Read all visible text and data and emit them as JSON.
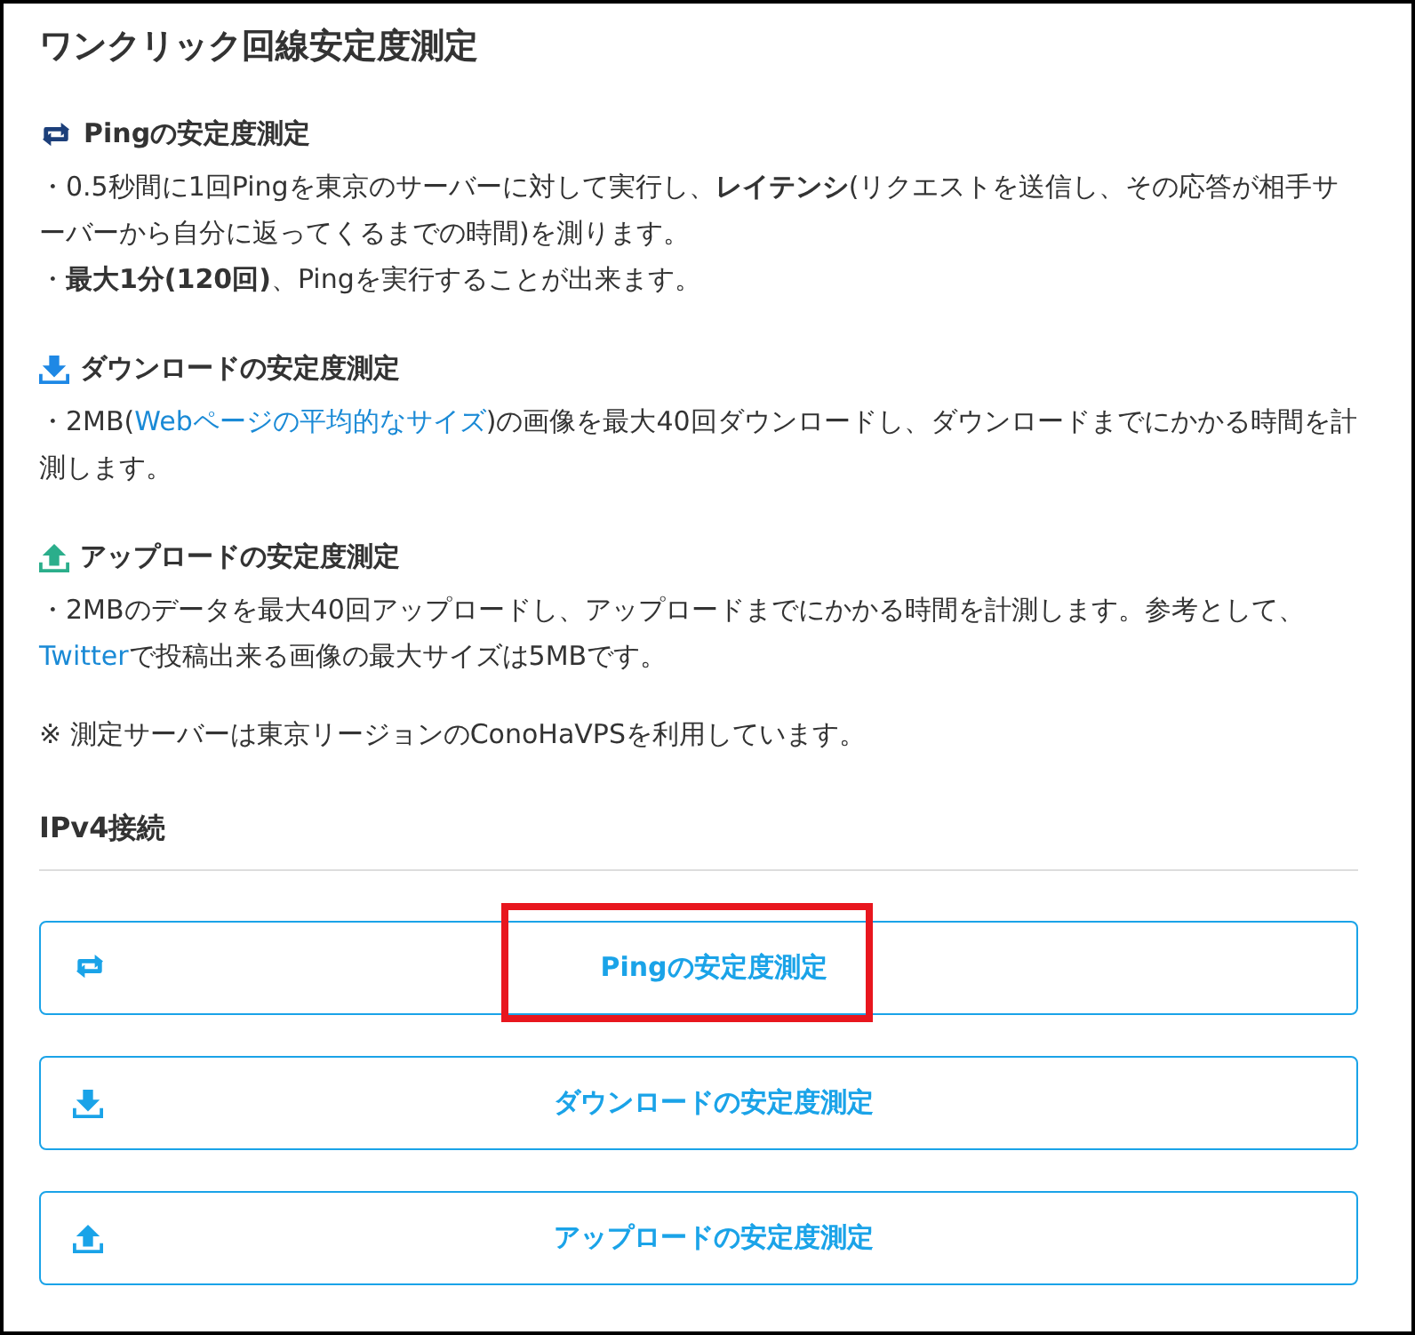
{
  "title": "ワンクリック回線安定度測定",
  "sections": [
    {
      "kind": "ping",
      "heading": "Pingの安定度測定",
      "paragraphs": [
        [
          {
            "kind": "text",
            "text": "・0.5秒間に1回Pingを東京のサーバーに対して実行し、**レイテンシ**(リクエストを送信し、その応答が相手サーバーから自分に返ってくるまでの時間)を測ります。"
          }
        ],
        [
          {
            "kind": "text",
            "text": "・**最大1分(120回)**、Pingを実行することが出来ます。"
          }
        ]
      ]
    },
    {
      "kind": "download",
      "heading": "ダウンロードの安定度測定",
      "paragraphs": [
        [
          {
            "kind": "text",
            "text": "・2MB("
          },
          {
            "kind": "link",
            "text": "Webページの平均的なサイズ"
          },
          {
            "kind": "text",
            "text": ")の画像を最大40回ダウンロードし、ダウンロードまでにかかる時間を計測します。"
          }
        ]
      ]
    },
    {
      "kind": "upload",
      "heading": "アップロードの安定度測定",
      "paragraphs": [
        [
          {
            "kind": "text",
            "text": "・2MBのデータを最大40回アップロードし、アップロードまでにかかる時間を計測します。参考として、"
          },
          {
            "kind": "link",
            "text": "Twitter"
          },
          {
            "kind": "text",
            "text": "で投稿出来る画像の最大サイズは5MBです。"
          }
        ]
      ]
    }
  ],
  "note": "※ 測定サーバーは東京リージョンのConoHaVPSを利用しています。",
  "connection": {
    "heading": "IPv4接続",
    "buttons": [
      {
        "kind": "ping",
        "label": "Pingの安定度測定",
        "highlighted": true
      },
      {
        "kind": "download",
        "label": "ダウンロードの安定度測定",
        "highlighted": false
      },
      {
        "kind": "upload",
        "label": "アップロードの安定度測定",
        "highlighted": false
      }
    ]
  }
}
